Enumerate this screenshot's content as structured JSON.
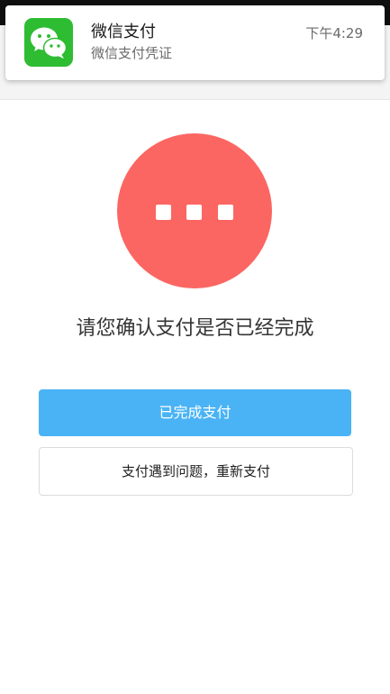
{
  "notification": {
    "app_icon": "wechat-icon",
    "title": "微信支付",
    "subtitle": "微信支付凭证",
    "time": "下午4:29"
  },
  "status": {
    "icon": "more-dots-icon",
    "circle_color": "#fb6662",
    "prompt": "请您确认支付是否已经完成"
  },
  "actions": {
    "completed_label": "已完成支付",
    "completed_color": "#4ab3f5",
    "retry_label": "支付遇到问题，重新支付"
  }
}
